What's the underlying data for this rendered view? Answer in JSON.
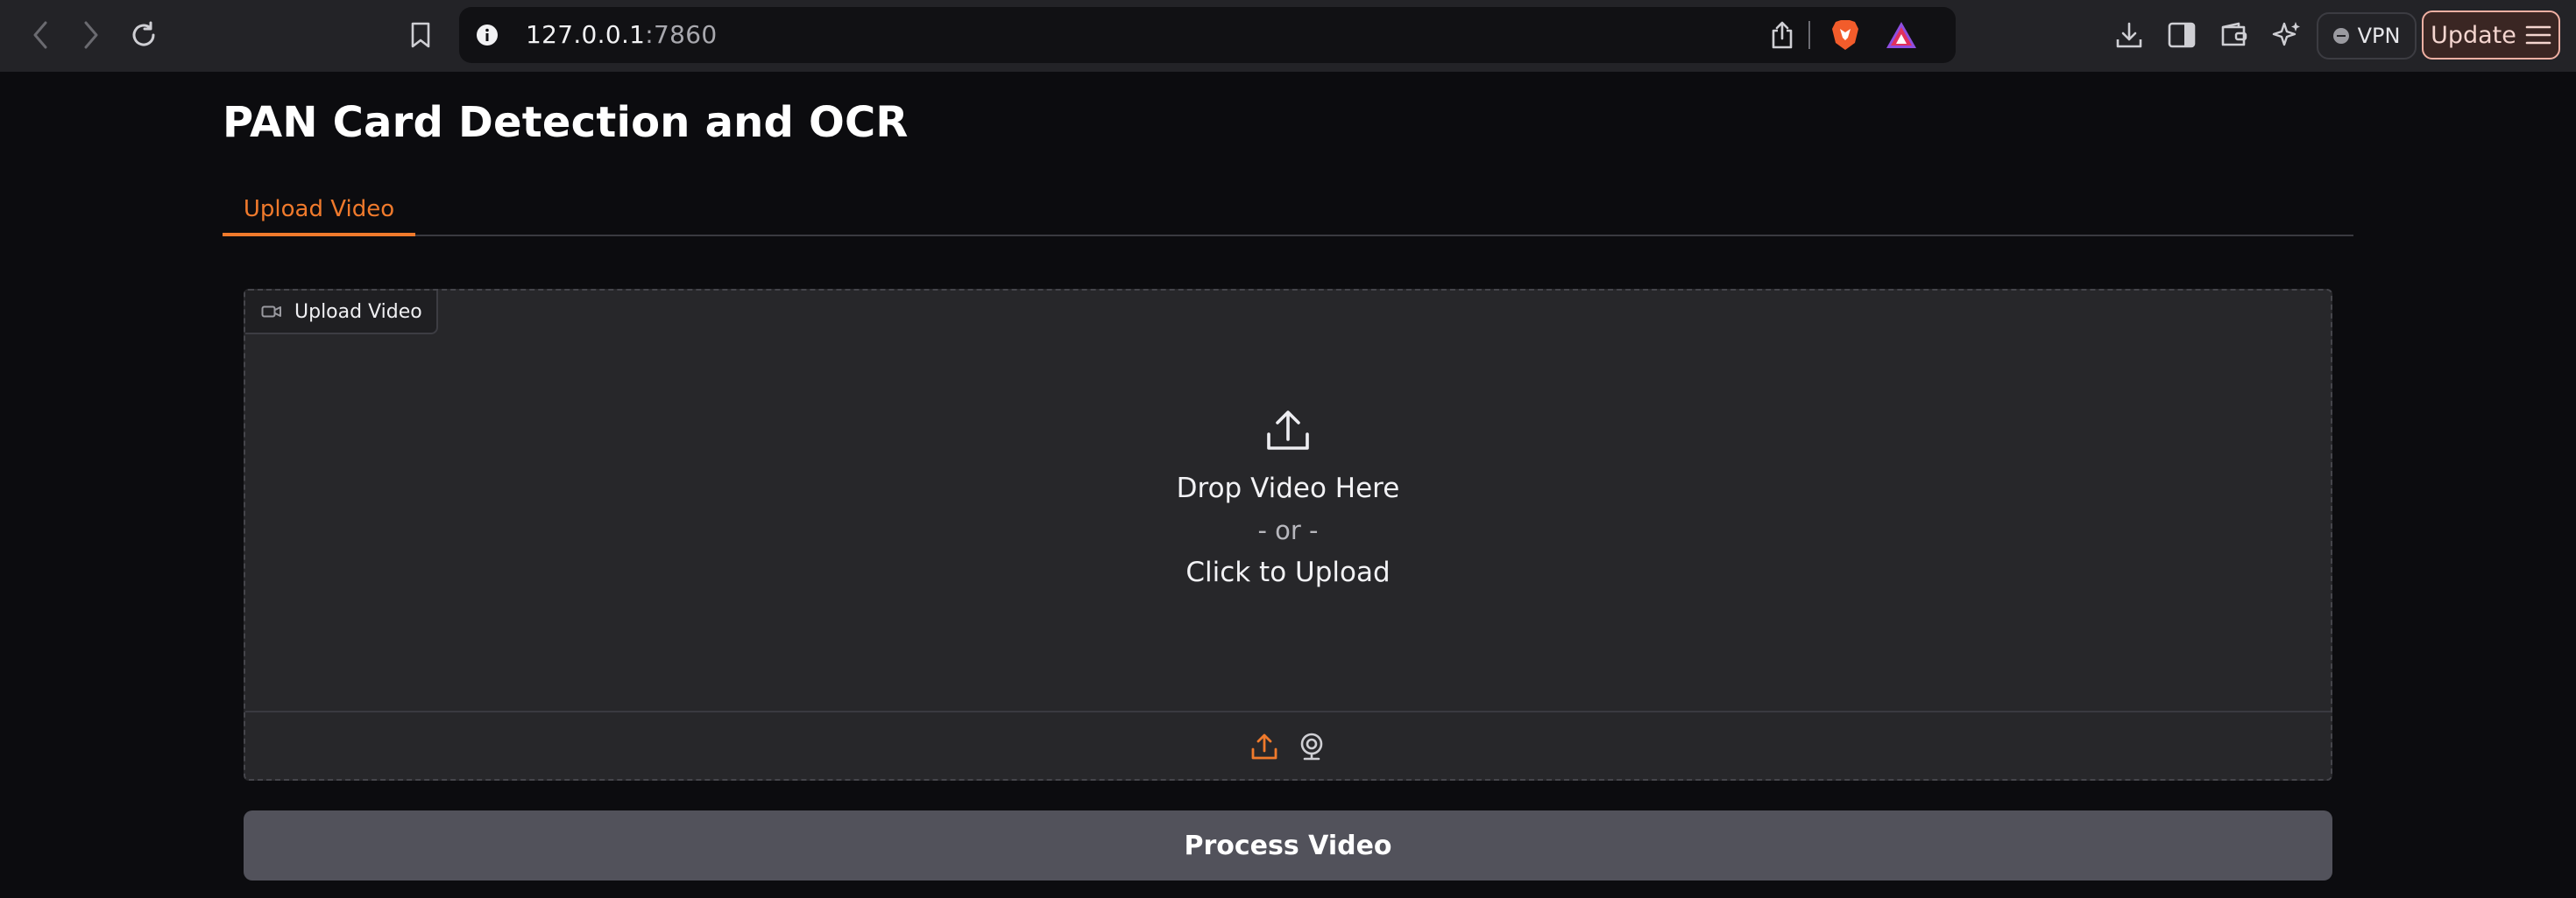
{
  "browser": {
    "url_host": "127.0.0.1",
    "url_port": ":7860",
    "vpn_label": "VPN",
    "update_label": "Update"
  },
  "page": {
    "title": "PAN Card Detection and OCR",
    "tabs": [
      {
        "label": "Upload Video",
        "active": true
      }
    ]
  },
  "upload": {
    "label": "Upload Video",
    "drop_text": "Drop Video Here",
    "or_text": "- or -",
    "click_text": "Click to Upload",
    "sources": [
      "upload-icon",
      "webcam-icon"
    ]
  },
  "actions": {
    "process_label": "Process Video"
  },
  "colors": {
    "accent": "#f07a2c",
    "background": "#0c0c0f",
    "panel": "#27272a",
    "button": "#52525b"
  }
}
